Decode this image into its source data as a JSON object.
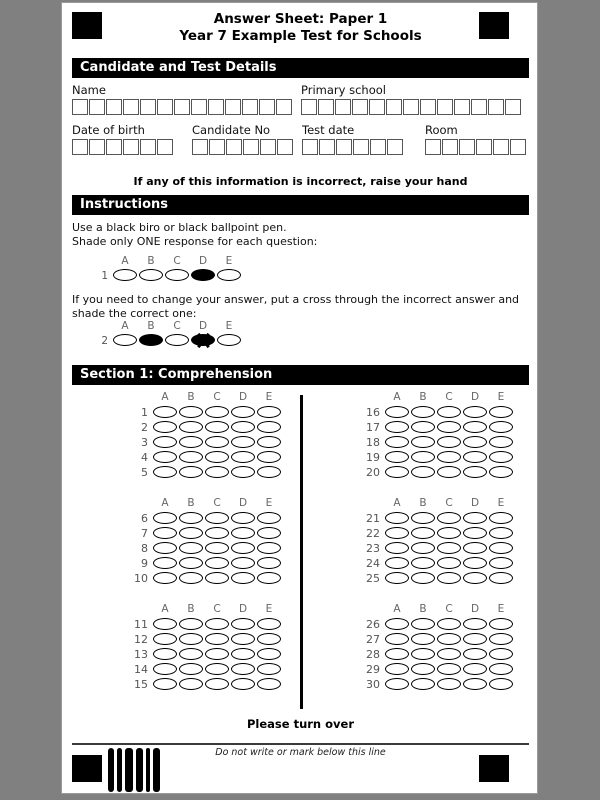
{
  "document": {
    "title_line1": "Answer Sheet: Paper 1",
    "title_line2": "Year 7 Example Test for Schools"
  },
  "candidate_section": {
    "heading": "Candidate and Test Details",
    "fields": [
      {
        "label": "Name",
        "boxes": 13
      },
      {
        "label": "Primary school",
        "boxes": 13
      },
      {
        "label": "Date of birth",
        "boxes": 6
      },
      {
        "label": "Candidate No",
        "boxes": 6
      },
      {
        "label": "Test date",
        "boxes": 6
      },
      {
        "label": "Room",
        "boxes": 6
      }
    ],
    "notice": "If any of this information is incorrect, raise your hand"
  },
  "instructions_section": {
    "heading": "Instructions",
    "text_line1": "Use a black biro or black ballpoint pen.",
    "text_line2": "Shade only ONE response for each question:",
    "text_line3": "If you need to change your answer, put a cross through the incorrect answer and shade the correct one:",
    "option_labels": [
      "A",
      "B",
      "C",
      "D",
      "E"
    ],
    "examples": [
      {
        "number": "1",
        "marks": [
          "empty",
          "empty",
          "empty",
          "filled",
          "empty"
        ]
      },
      {
        "number": "2",
        "marks": [
          "empty",
          "filled",
          "empty",
          "crossed",
          "empty"
        ]
      }
    ]
  },
  "answer_section": {
    "heading": "Section 1: Comprehension",
    "option_labels": [
      "A",
      "B",
      "C",
      "D",
      "E"
    ],
    "columns": [
      {
        "blocks": [
          {
            "questions": [
              "1",
              "2",
              "3",
              "4",
              "5"
            ]
          },
          {
            "questions": [
              "6",
              "7",
              "8",
              "9",
              "10"
            ]
          },
          {
            "questions": [
              "11",
              "12",
              "13",
              "14",
              "15"
            ]
          }
        ]
      },
      {
        "blocks": [
          {
            "questions": [
              "16",
              "17",
              "18",
              "19",
              "20"
            ]
          },
          {
            "questions": [
              "21",
              "22",
              "23",
              "24",
              "25"
            ]
          },
          {
            "questions": [
              "26",
              "27",
              "28",
              "29",
              "30"
            ]
          }
        ]
      }
    ],
    "turn_over": "Please turn over"
  },
  "footer": {
    "note": "Do not write or mark below this line",
    "barcode_widths": [
      6,
      5,
      8,
      7,
      4,
      7
    ]
  },
  "colors": {
    "ink": "#000000",
    "bar_background": "#000000",
    "bar_text": "#ffffff",
    "label_gray": "#666666",
    "box_border": "#555555",
    "page_background": "#ffffff",
    "outside_background": "#808080"
  }
}
